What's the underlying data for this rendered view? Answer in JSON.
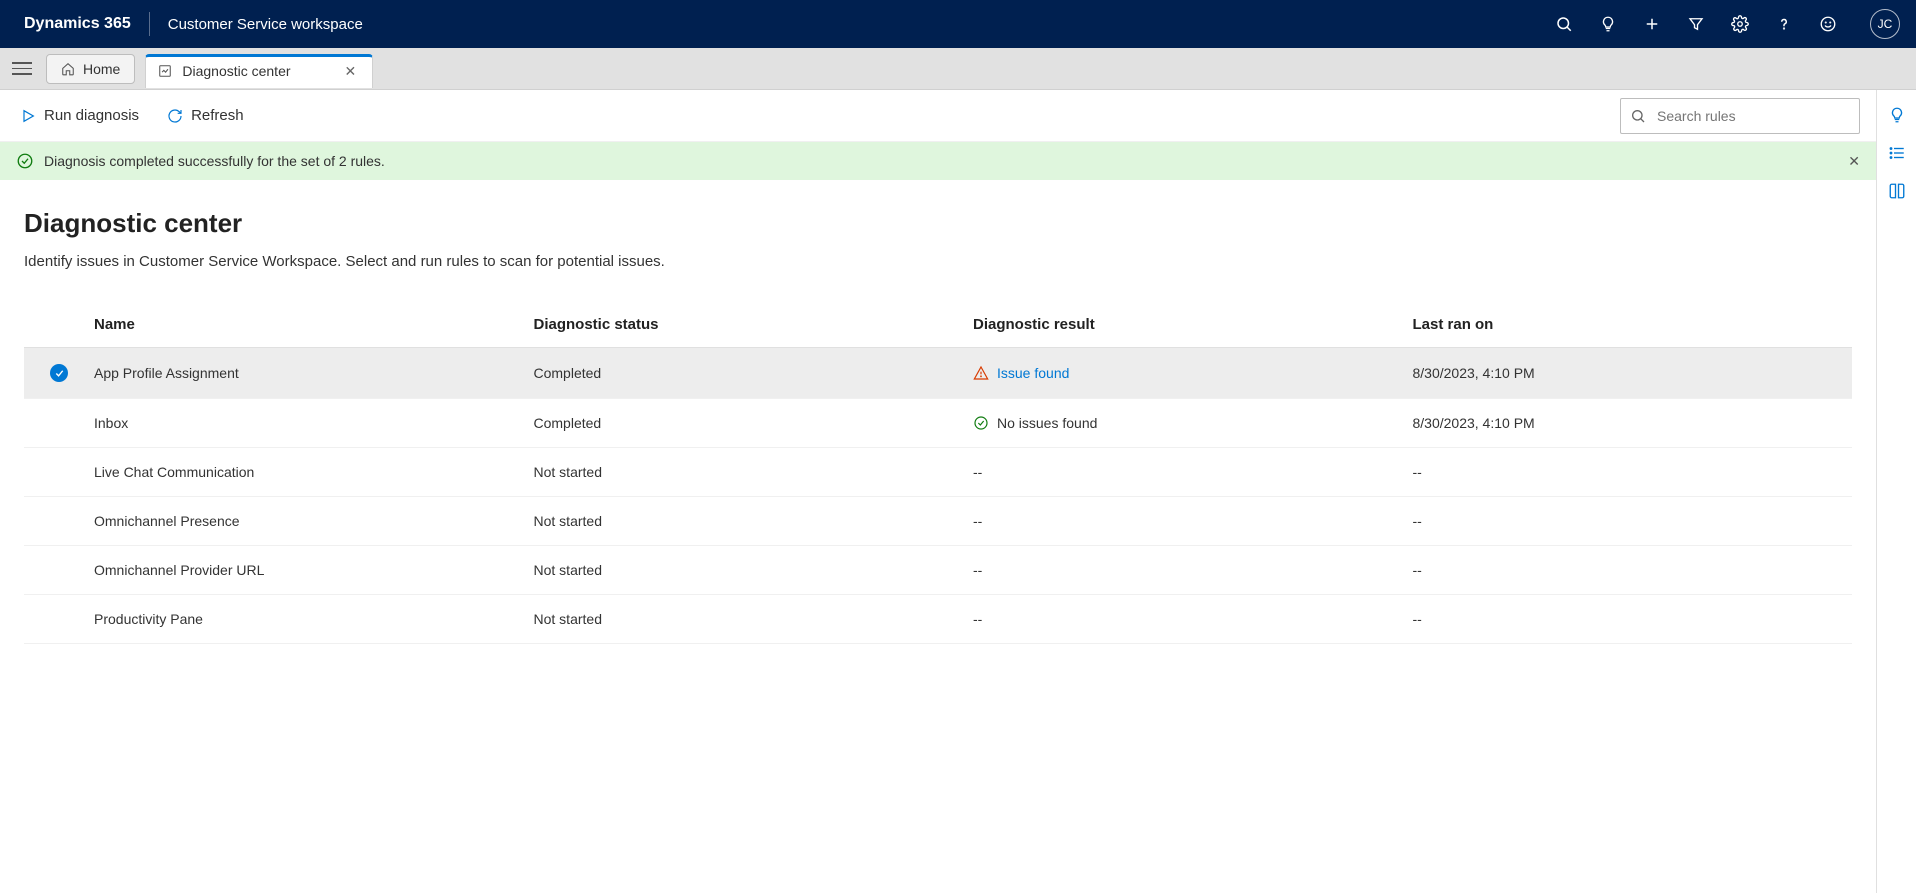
{
  "header": {
    "brand": "Dynamics 365",
    "workspace": "Customer Service workspace",
    "avatar_initials": "JC"
  },
  "tabs": {
    "home": "Home",
    "diagnostic": "Diagnostic center"
  },
  "commands": {
    "run_diagnosis": "Run diagnosis",
    "refresh": "Refresh"
  },
  "search": {
    "placeholder": "Search rules"
  },
  "banner": {
    "message": "Diagnosis completed successfully for the set of 2 rules."
  },
  "page": {
    "title": "Diagnostic center",
    "description": "Identify issues in Customer Service Workspace. Select and run rules to scan for potential issues."
  },
  "table": {
    "headers": {
      "name": "Name",
      "status": "Diagnostic status",
      "result": "Diagnostic result",
      "last_ran": "Last ran on"
    },
    "rows": [
      {
        "selected": true,
        "name": "App Profile Assignment",
        "status": "Completed",
        "result_type": "issue",
        "result_text": "Issue found",
        "last_ran": "8/30/2023, 4:10 PM"
      },
      {
        "selected": false,
        "name": "Inbox",
        "status": "Completed",
        "result_type": "ok",
        "result_text": "No issues found",
        "last_ran": "8/30/2023, 4:10 PM"
      },
      {
        "selected": false,
        "name": "Live Chat Communication",
        "status": "Not started",
        "result_type": "none",
        "result_text": "--",
        "last_ran": "--"
      },
      {
        "selected": false,
        "name": "Omnichannel Presence",
        "status": "Not started",
        "result_type": "none",
        "result_text": "--",
        "last_ran": "--"
      },
      {
        "selected": false,
        "name": "Omnichannel Provider URL",
        "status": "Not started",
        "result_type": "none",
        "result_text": "--",
        "last_ran": "--"
      },
      {
        "selected": false,
        "name": "Productivity Pane",
        "status": "Not started",
        "result_type": "none",
        "result_text": "--",
        "last_ran": "--"
      }
    ]
  }
}
